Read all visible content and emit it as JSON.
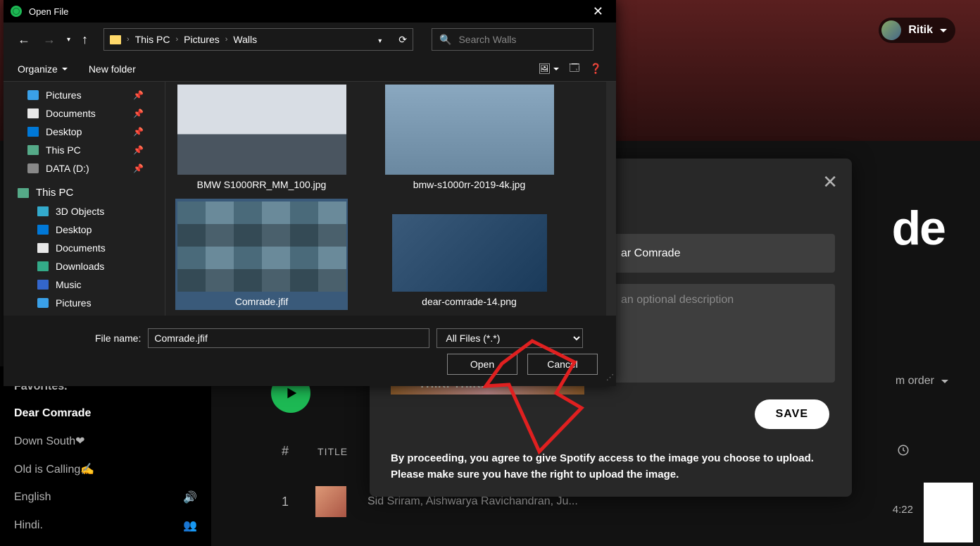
{
  "spotify": {
    "user": "Ritik",
    "playlist_big": "de",
    "sidebar": {
      "favorites": "Favorites.",
      "items": [
        "Dear Comrade",
        "Down South❤",
        "Old is Calling✍",
        "English",
        "Hindi."
      ]
    },
    "custom_order": "m order",
    "track_header": {
      "hash": "#",
      "title": "TITLE"
    },
    "track1": {
      "num": "1",
      "artists": "Sid Sriram, Aishwarya Ravichandran, Ju...",
      "duration": "4:22"
    }
  },
  "modal": {
    "name_partial": "ar Comrade",
    "desc_placeholder": "an optional description",
    "save": "SAVE",
    "thiri": "THIRI THIRI",
    "disclaimer": "By proceeding, you agree to give Spotify access to the image you choose to upload. Please make sure you have the right to upload the image."
  },
  "dialog": {
    "title": "Open File",
    "breadcrumb": [
      "This PC",
      "Pictures",
      "Walls"
    ],
    "search_placeholder": "Search Walls",
    "organize": "Organize",
    "new_folder": "New folder",
    "tree": {
      "quick": [
        "Pictures",
        "Documents",
        "Desktop",
        "This PC",
        "DATA (D:)"
      ],
      "pc_label": "This PC",
      "pc_children": [
        "3D Objects",
        "Desktop",
        "Documents",
        "Downloads",
        "Music",
        "Pictures"
      ]
    },
    "files": [
      {
        "name": "BMW S1000RR_MM_100.jpg",
        "thumb": "bike1"
      },
      {
        "name": "bmw-s1000rr-2019-4k.jpg",
        "thumb": "bike2"
      },
      {
        "name": "Comrade.jfif",
        "thumb": "comrade",
        "selected": true
      },
      {
        "name": "dear-comrade-14.png",
        "thumb": "dear"
      }
    ],
    "filename_label": "File name:",
    "filename_value": "Comrade.jfif",
    "filter": "All Files (*.*)",
    "open": "Open",
    "cancel": "Cancel"
  }
}
